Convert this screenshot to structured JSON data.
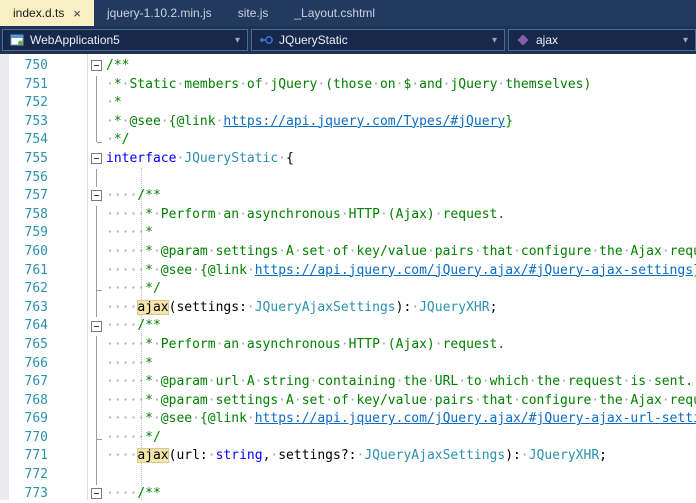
{
  "tabs": [
    {
      "label": "index.d.ts",
      "active": true,
      "close_icon": "×"
    },
    {
      "label": "jquery-1.10.2.min.js",
      "active": false
    },
    {
      "label": "site.js",
      "active": false
    },
    {
      "label": "_Layout.cshtml",
      "active": false
    }
  ],
  "navigation_bar": {
    "project_dropdown": {
      "value": "WebApplication5",
      "icon": "project-icon",
      "chevron": "▾"
    },
    "type_dropdown": {
      "value": "JQueryStatic",
      "icon": "interface-icon",
      "chevron": "▾"
    },
    "member_dropdown": {
      "value": "ajax",
      "icon": "method-icon",
      "chevron": "▾"
    }
  },
  "colors": {
    "tab_bar_bg": "#233a5e",
    "active_tab_bg": "#f8efc4",
    "editor_bg": "#ffffff",
    "comment": "#008000",
    "keyword": "#0000ff",
    "type": "#2b91af",
    "link": "#0b6cc4",
    "line_number": "#2b91af",
    "whitespace_dot": "#97a7b7",
    "reference_highlight": "#f3e6a8"
  },
  "editor": {
    "lines": [
      {
        "n": 750,
        "f": "box",
        "s": [
          [
            "cm",
            "/**"
          ]
        ]
      },
      {
        "n": 751,
        "f": "line",
        "s": [
          [
            "cm",
            " * Static members of jQuery (those on $ and jQuery themselves)"
          ]
        ]
      },
      {
        "n": 752,
        "f": "line",
        "s": [
          [
            "cm",
            " *"
          ]
        ]
      },
      {
        "n": 753,
        "f": "line",
        "s": [
          [
            "cm",
            " * @see {@link "
          ],
          [
            "ln",
            "https://api.jquery.com/Types/#jQuery"
          ],
          [
            "cm",
            "}"
          ]
        ]
      },
      {
        "n": 754,
        "f": "endtop",
        "s": [
          [
            "cm",
            " */"
          ]
        ]
      },
      {
        "n": 755,
        "f": "box",
        "s": [
          [
            "kw",
            "interface"
          ],
          [
            "pl",
            " "
          ],
          [
            "ty",
            "JQueryStatic"
          ],
          [
            "pl",
            " {"
          ]
        ]
      },
      {
        "n": 756,
        "f": "line",
        "s": []
      },
      {
        "n": 757,
        "f": "box",
        "s": [
          [
            "pl",
            "    "
          ],
          [
            "cm",
            "/**"
          ]
        ]
      },
      {
        "n": 758,
        "f": "line",
        "s": [
          [
            "cm",
            "     * Perform an asynchronous HTTP (Ajax) request."
          ]
        ]
      },
      {
        "n": 759,
        "f": "line",
        "s": [
          [
            "cm",
            "     *"
          ]
        ]
      },
      {
        "n": 760,
        "f": "line",
        "s": [
          [
            "cm",
            "     * @param settings A set of key/value pairs that configure the Ajax request. All settings are optional."
          ]
        ]
      },
      {
        "n": 761,
        "f": "line",
        "s": [
          [
            "cm",
            "     * @see {@link "
          ],
          [
            "ln",
            "https://api.jquery.com/jQuery.ajax/#jQuery-ajax-settings"
          ],
          [
            "cm",
            "}"
          ]
        ]
      },
      {
        "n": 762,
        "f": "end",
        "s": [
          [
            "cm",
            "     */"
          ]
        ]
      },
      {
        "n": 763,
        "f": "line",
        "s": [
          [
            "pl",
            "    "
          ],
          [
            "hl",
            "ajax"
          ],
          [
            "pl",
            "(settings: "
          ],
          [
            "ty",
            "JQueryAjaxSettings"
          ],
          [
            "pl",
            "): "
          ],
          [
            "ty",
            "JQueryXHR"
          ],
          [
            "pl",
            ";"
          ]
        ]
      },
      {
        "n": 764,
        "f": "box",
        "s": [
          [
            "pl",
            "    "
          ],
          [
            "cm",
            "/**"
          ]
        ]
      },
      {
        "n": 765,
        "f": "line",
        "s": [
          [
            "cm",
            "     * Perform an asynchronous HTTP (Ajax) request."
          ]
        ]
      },
      {
        "n": 766,
        "f": "line",
        "s": [
          [
            "cm",
            "     *"
          ]
        ]
      },
      {
        "n": 767,
        "f": "line",
        "s": [
          [
            "cm",
            "     * @param url A string containing the URL to which the request is sent."
          ]
        ]
      },
      {
        "n": 768,
        "f": "line",
        "s": [
          [
            "cm",
            "     * @param settings A set of key/value pairs that configure the Ajax request. All settings are optional."
          ]
        ]
      },
      {
        "n": 769,
        "f": "line",
        "s": [
          [
            "cm",
            "     * @see {@link "
          ],
          [
            "ln",
            "https://api.jquery.com/jQuery.ajax/#jQuery-ajax-url-settings"
          ],
          [
            "cm",
            "}"
          ]
        ]
      },
      {
        "n": 770,
        "f": "end",
        "s": [
          [
            "cm",
            "     */"
          ]
        ]
      },
      {
        "n": 771,
        "f": "line",
        "s": [
          [
            "pl",
            "    "
          ],
          [
            "hl",
            "ajax"
          ],
          [
            "pl",
            "(url: "
          ],
          [
            "kw",
            "string"
          ],
          [
            "pl",
            ", settings?: "
          ],
          [
            "ty",
            "JQueryAjaxSettings"
          ],
          [
            "pl",
            "): "
          ],
          [
            "ty",
            "JQueryXHR"
          ],
          [
            "pl",
            ";"
          ]
        ]
      },
      {
        "n": 772,
        "f": "line",
        "s": []
      },
      {
        "n": 773,
        "f": "box",
        "s": [
          [
            "pl",
            "    "
          ],
          [
            "cm",
            "/**"
          ]
        ]
      }
    ]
  }
}
